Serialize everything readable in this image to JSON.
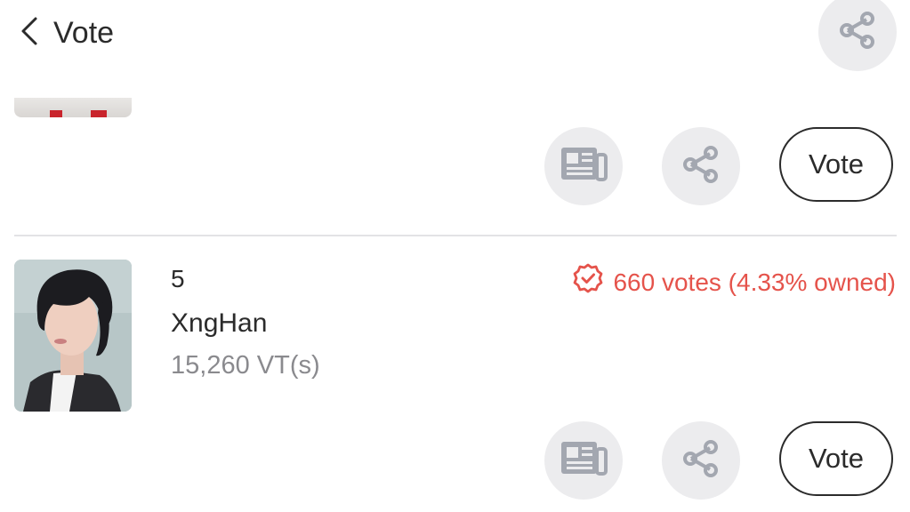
{
  "header": {
    "back_icon": "chevron-left-icon",
    "title": "Vote",
    "share_icon": "share-icon"
  },
  "actions_label": "Vote",
  "icons": {
    "news": "newspaper-icon",
    "share": "share-icon",
    "badge": "verified-badge-icon"
  },
  "colors": {
    "accent_red": "#e5534b",
    "button_bg": "#ececee",
    "icon_gray": "#a3a7b0",
    "text_dark": "#2b2b2b",
    "text_gray": "#8a8a8e"
  },
  "items": [
    {
      "rank": "5",
      "name": "XngHan",
      "vt": "15,260 VT(s)",
      "votes": "660 votes (4.33% owned)"
    }
  ]
}
